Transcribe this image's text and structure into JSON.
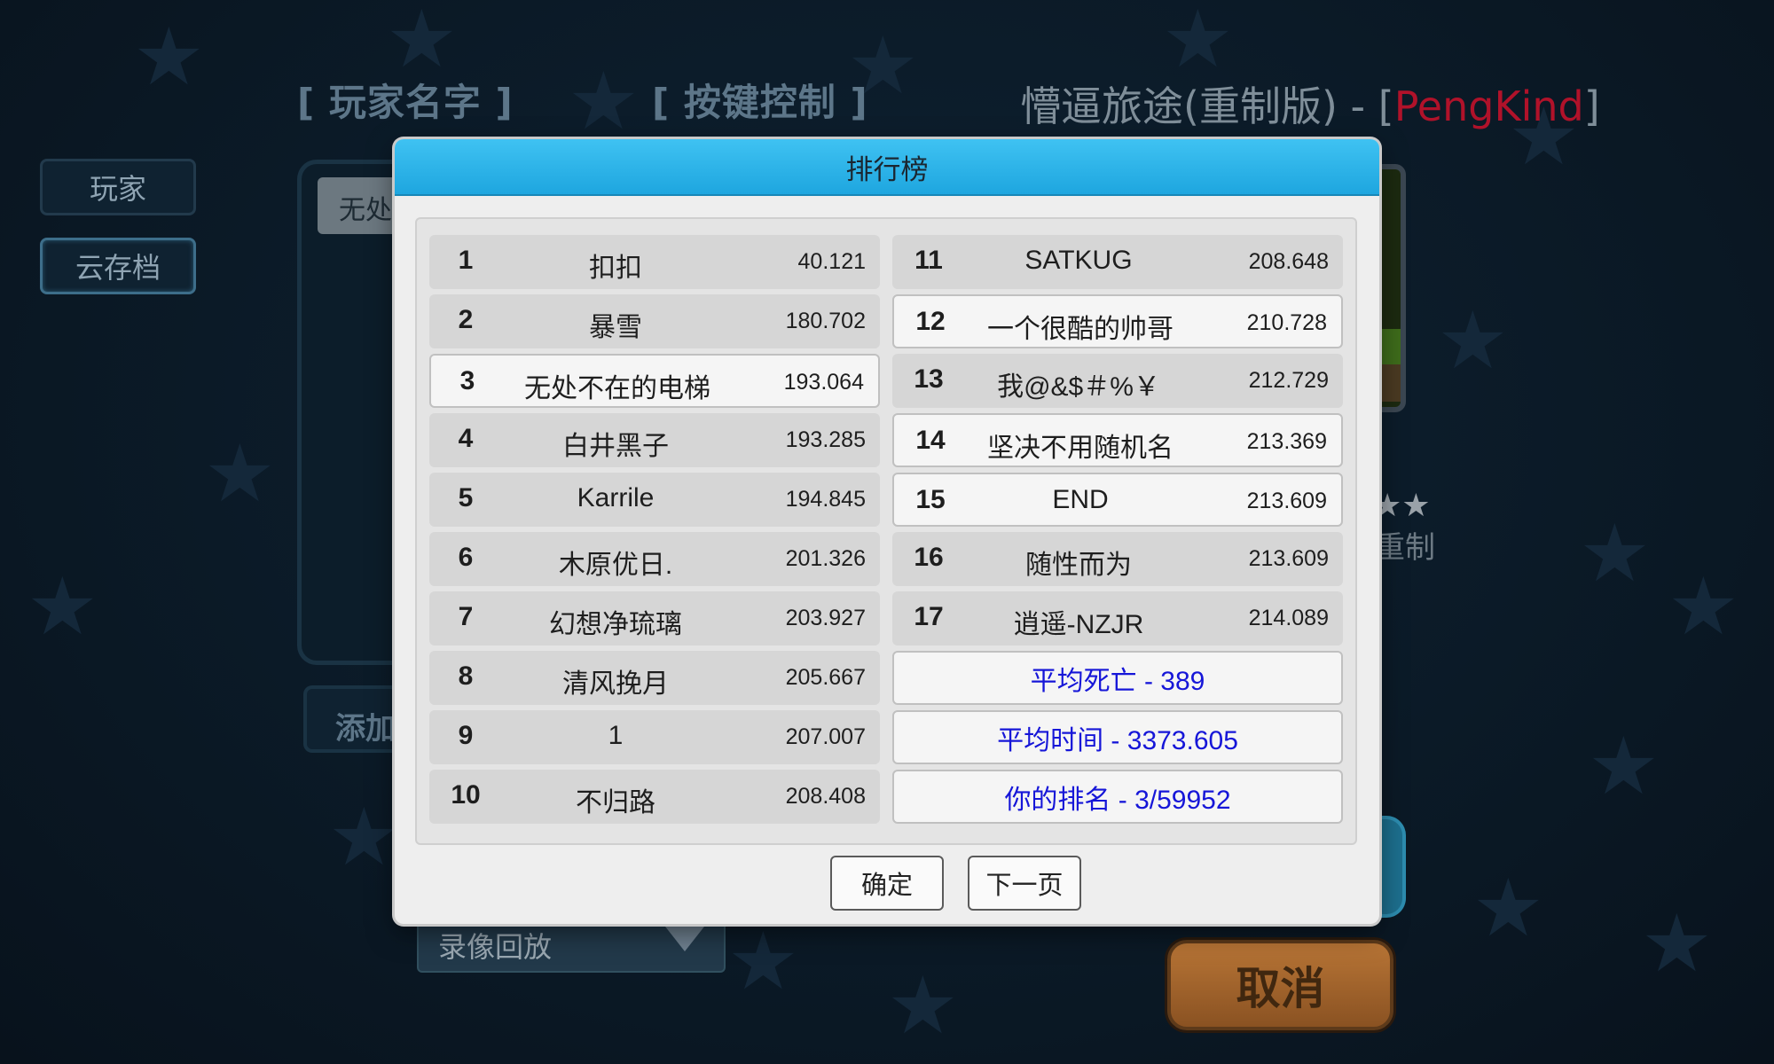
{
  "background": {
    "tab_player_name": "[ 玩家名字 ]",
    "tab_key_controls": "[ 按键控制 ]",
    "game_title_prefix": "懵逼旅途(重制版) - [",
    "game_title_author": "PengKind",
    "game_title_suffix": "]",
    "sidebar": [
      {
        "label": "玩家"
      },
      {
        "label": "云存档"
      }
    ],
    "player_chip": "无处",
    "add_button": "添加",
    "replay_select_value": "录像回放",
    "right_stars": "★★",
    "right_remade": "重制",
    "cancel_button": "取消"
  },
  "leaderboard": {
    "title": "排行榜",
    "entries": [
      {
        "rank": "1",
        "name": "扣扣",
        "score": "40.121"
      },
      {
        "rank": "2",
        "name": "暴雪",
        "score": "180.702"
      },
      {
        "rank": "3",
        "name": "无处不在的电梯",
        "score": "193.064"
      },
      {
        "rank": "4",
        "name": "白井黑子",
        "score": "193.285"
      },
      {
        "rank": "5",
        "name": "Karrile",
        "score": "194.845"
      },
      {
        "rank": "6",
        "name": "木原优日.",
        "score": "201.326"
      },
      {
        "rank": "7",
        "name": "幻想净琉璃",
        "score": "203.927"
      },
      {
        "rank": "8",
        "name": "清风挽月",
        "score": "205.667"
      },
      {
        "rank": "9",
        "name": "1",
        "score": "207.007"
      },
      {
        "rank": "10",
        "name": "不归路",
        "score": "208.408"
      },
      {
        "rank": "11",
        "name": "SATKUG",
        "score": "208.648"
      },
      {
        "rank": "12",
        "name": "一个很酷的帅哥",
        "score": "210.728"
      },
      {
        "rank": "13",
        "name": "我@&$＃%￥",
        "score": "212.729"
      },
      {
        "rank": "14",
        "name": "坚决不用随机名",
        "score": "213.369"
      },
      {
        "rank": "15",
        "name": "END",
        "score": "213.609"
      },
      {
        "rank": "16",
        "name": "随性而为",
        "score": "213.609"
      },
      {
        "rank": "17",
        "name": "逍遥-NZJR",
        "score": "214.089"
      }
    ],
    "stats": {
      "avg_deaths": "平均死亡 - 389",
      "avg_time": "平均时间 - 3373.605",
      "your_rank": "你的排名 - 3/59952"
    },
    "confirm_button": "确定",
    "next_page_button": "下一页",
    "colors": {
      "header": "#1ea6df",
      "stat_text": "#1616d8",
      "author_name": "#b0122a",
      "cancel_button": "#a56630"
    }
  }
}
